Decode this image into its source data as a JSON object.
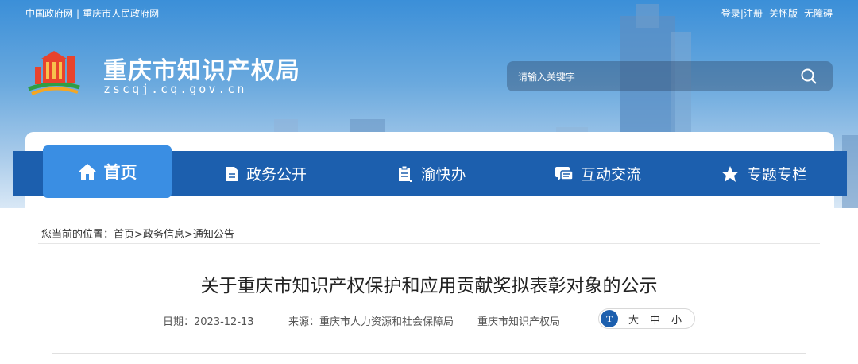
{
  "topbar": {
    "links_left": [
      "中国政府网",
      "重庆市人民政府网"
    ],
    "separator": "|",
    "links_right": [
      "登录|注册",
      "关怀版",
      "无障碍"
    ]
  },
  "header": {
    "site_title": "重庆市知识产权局",
    "domain": "zscqj.cq.gov.cn",
    "search_placeholder": "请输入关键字"
  },
  "nav": {
    "items": [
      {
        "label": "首页",
        "icon": "home-icon",
        "active": true
      },
      {
        "label": "政务公开",
        "icon": "document-icon"
      },
      {
        "label": "渝快办",
        "icon": "clipboard-icon"
      },
      {
        "label": "互动交流",
        "icon": "chat-icon"
      },
      {
        "label": "专题专栏",
        "icon": "star-icon"
      }
    ]
  },
  "breadcrumb": {
    "prefix": "您当前的位置：",
    "items": [
      "首页",
      "政务信息",
      "通知公告"
    ],
    "separator": ">"
  },
  "article": {
    "title": "关于重庆市知识产权保护和应用贡献奖拟表彰对象的公示",
    "date_label": "日期：",
    "date": "2023-12-13",
    "source_label": "来源：",
    "source": "重庆市人力资源和社会保障局",
    "source2": "重庆市知识产权局"
  },
  "font_size": {
    "icon_text": "T",
    "options": [
      "大",
      "中",
      "小"
    ]
  },
  "colors": {
    "nav_bg": "#1c5fae",
    "nav_active": "#3a8ee3",
    "banner_top": "#3b8fd8"
  }
}
